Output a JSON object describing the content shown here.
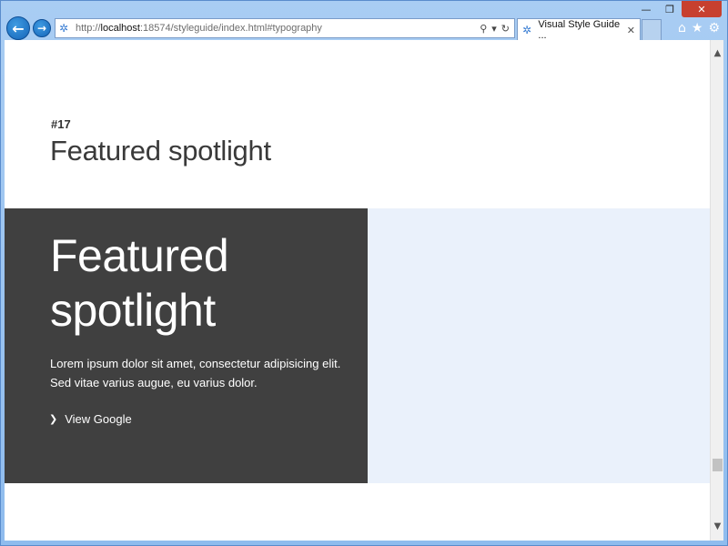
{
  "browser": {
    "address": {
      "protocol": "http://",
      "host": "localhost",
      "rest": ":18574/styleguide/index.html#typography"
    },
    "tab_title": "Visual Style Guide ...",
    "window_controls": {
      "minimize": "—",
      "restore": "❐",
      "close": "✕"
    }
  },
  "page": {
    "section_number": "#17",
    "section_title": "Featured spotlight",
    "spotlight": {
      "heading_line1": "Featured",
      "heading_line2": "spotlight",
      "body_line1": "Lorem ipsum dolor sit amet, consectetur adipisicing elit.",
      "body_line2": "Sed vitae varius augue, eu varius dolor.",
      "link_label": "View Google"
    }
  },
  "colors": {
    "spotlight_dark": "#404040",
    "spotlight_light": "#eaf1fb",
    "browser_accent": "#1565b8"
  }
}
